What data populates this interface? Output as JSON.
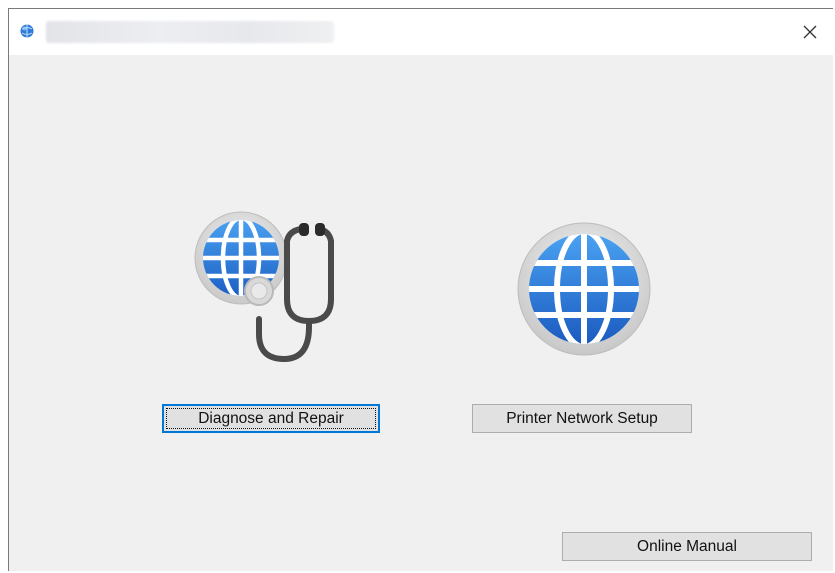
{
  "window": {
    "title": "",
    "close_glyph": "✕"
  },
  "tools": [
    {
      "label": "Diagnose and Repair",
      "icon": "stethoscope-globe-icon",
      "focused": true
    },
    {
      "label": "Printer Network Setup",
      "icon": "globe-icon",
      "focused": false
    }
  ],
  "footer": {
    "online_manual_label": "Online Manual"
  },
  "colors": {
    "window_bg": "#f0f0f0",
    "titlebar_bg": "#ffffff",
    "button_bg": "#e1e1e1",
    "button_border": "#adadad",
    "focus_border": "#0078d7",
    "globe_blue": "#2e74d8"
  }
}
